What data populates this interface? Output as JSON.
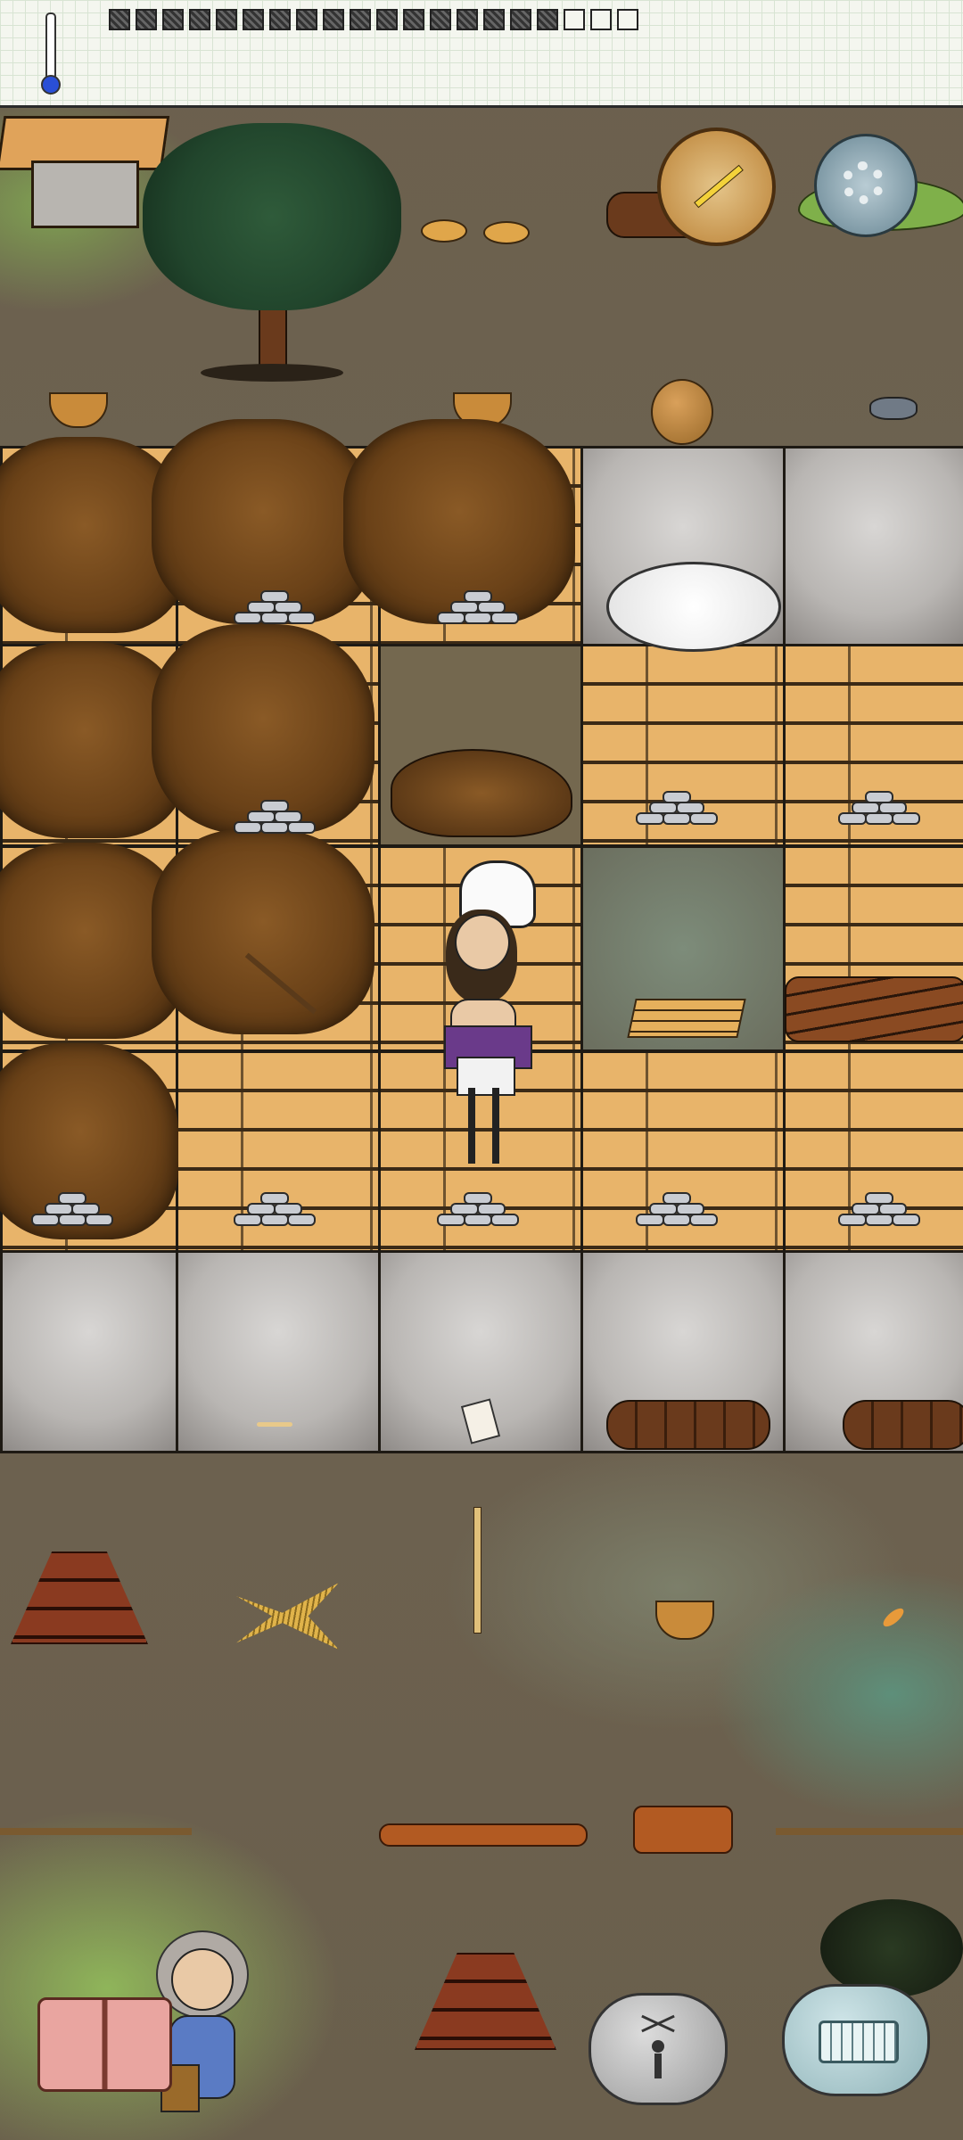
{
  "hud": {
    "temperature_icon": "thermometer-icon",
    "food_pips": {
      "filled": 17,
      "total": 20
    },
    "compass_icon": "compass-icon",
    "settings_icon": "gear-icon"
  },
  "colors": {
    "plank": "#e8b46a",
    "stone": "#b9b6b3",
    "fur": "#6b4218",
    "dirt": "#6e6352",
    "grass": "#8fb55a",
    "compass_gold": "#d4a24a",
    "gear_blue": "#8aa7b3"
  },
  "buttons": {
    "recipe_book_icon": "open-book-icon",
    "emote_icon": "puppet-emote-icon",
    "keyboard_icon": "keyboard-icon"
  },
  "characters": {
    "chef": "chef-character",
    "player": "elder-woman-character"
  }
}
